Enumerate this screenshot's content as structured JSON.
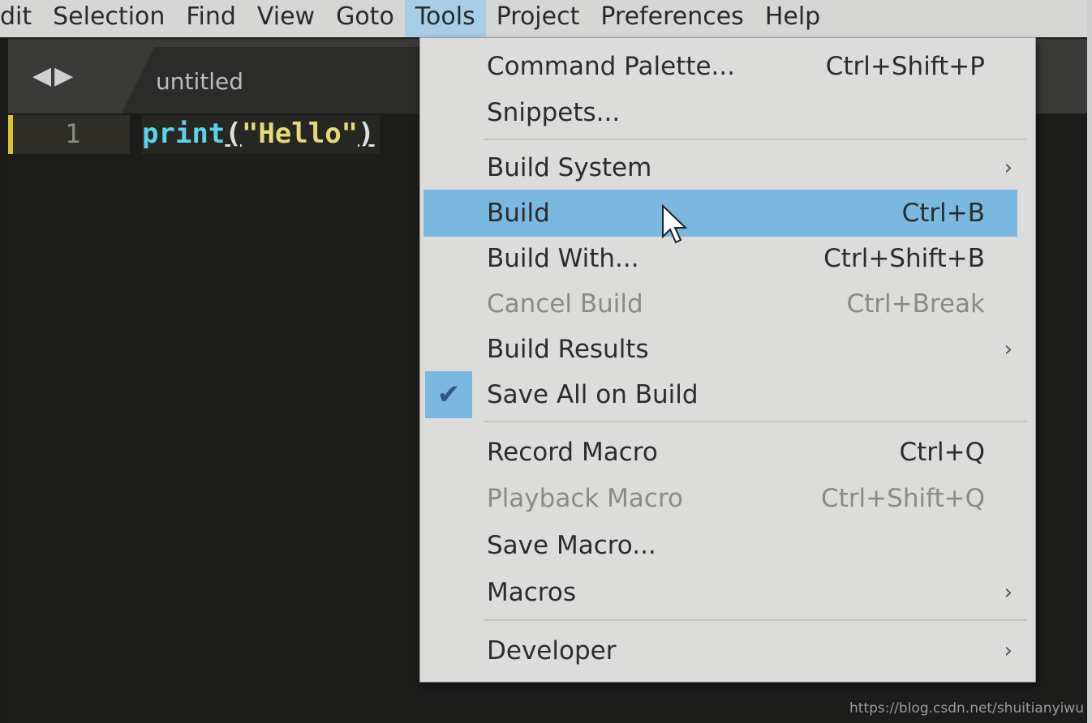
{
  "menubar": {
    "items": [
      "dit",
      "Selection",
      "Find",
      "View",
      "Goto",
      "Tools",
      "Project",
      "Preferences",
      "Help"
    ],
    "active": "Tools"
  },
  "tab": {
    "title": "untitled"
  },
  "editor": {
    "line_number": "1",
    "code": {
      "fn": "print",
      "open": "(",
      "str": "\"Hello\"",
      "close": ")"
    }
  },
  "tools_menu": {
    "items": [
      {
        "label": "Command Palette...",
        "shortcut": "Ctrl+Shift+P"
      },
      {
        "label": "Snippets...",
        "shortcut": ""
      },
      {
        "label": "Build System",
        "submenu": true
      },
      {
        "label": "Build",
        "shortcut": "Ctrl+B",
        "highlighted": true
      },
      {
        "label": "Build With...",
        "shortcut": "Ctrl+Shift+B"
      },
      {
        "label": "Cancel Build",
        "shortcut": "Ctrl+Break",
        "disabled": true
      },
      {
        "label": "Build Results",
        "submenu": true
      },
      {
        "label": "Save All on Build",
        "checked": true
      },
      {
        "label": "Record Macro",
        "shortcut": "Ctrl+Q"
      },
      {
        "label": "Playback Macro",
        "shortcut": "Ctrl+Shift+Q",
        "disabled": true
      },
      {
        "label": "Save Macro...",
        "shortcut": ""
      },
      {
        "label": "Macros",
        "submenu": true
      },
      {
        "label": "Developer",
        "submenu": true
      }
    ]
  },
  "watermark": "https://blog.csdn.net/shuitianyiwu",
  "colors": {
    "highlight": "#7ab8e0",
    "menu_bg": "#dcdcda",
    "editor_bg": "#1c1c1b"
  }
}
